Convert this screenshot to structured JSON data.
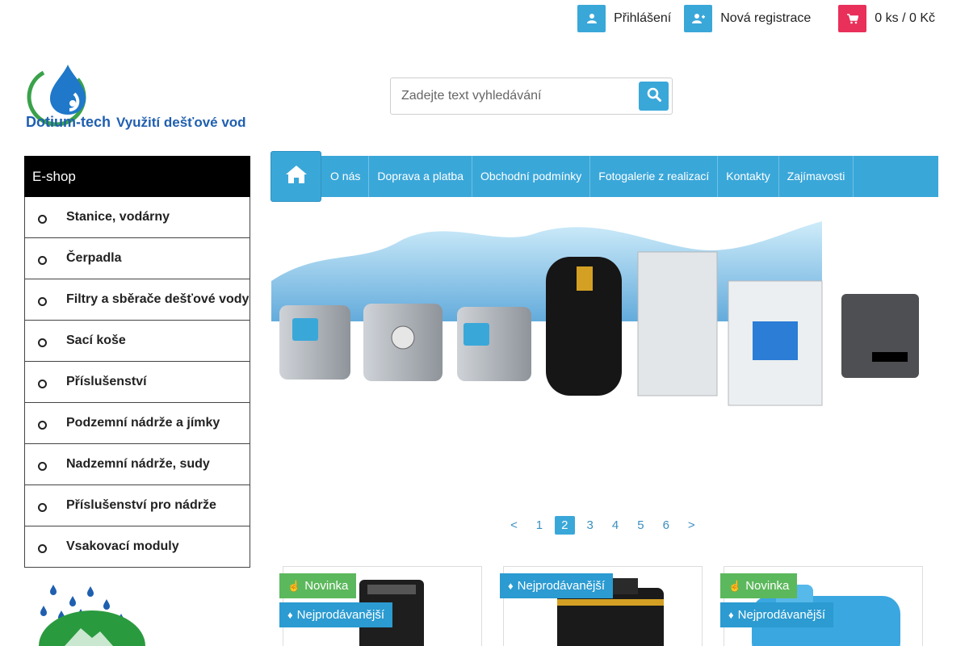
{
  "topbar": {
    "login_label": "Přihlášení",
    "register_label": "Nová registrace",
    "cart_label": "0 ks / 0 Kč"
  },
  "logo": {
    "name": "Dotium-tech",
    "tagline": "Využití dešťové vody"
  },
  "search": {
    "placeholder": "Zadejte text vyhledávání"
  },
  "sidebar": {
    "title": "E-shop",
    "items": [
      {
        "label": "Stanice, vodárny"
      },
      {
        "label": "Čerpadla"
      },
      {
        "label": "Filtry a sběrače dešťové vody"
      },
      {
        "label": "Sací koše"
      },
      {
        "label": "Příslušenství"
      },
      {
        "label": "Podzemní nádrže a jímky"
      },
      {
        "label": "Nadzemní nádrže, sudy"
      },
      {
        "label": "Příslušenství pro nádrže"
      },
      {
        "label": "Vsakovací moduly"
      }
    ]
  },
  "nav": {
    "links": [
      {
        "label": "O nás"
      },
      {
        "label": "Doprava a platba"
      },
      {
        "label": "Obchodní podmínky"
      },
      {
        "label": "Fotogalerie z realizací"
      },
      {
        "label": "Kontakty"
      },
      {
        "label": "Zajímavosti"
      }
    ]
  },
  "pager": {
    "prev": "<",
    "pages": [
      "1",
      "2",
      "3",
      "4",
      "5",
      "6"
    ],
    "active": "2",
    "next": ">"
  },
  "products": [
    {
      "badges": [
        {
          "type": "new",
          "label": "Novinka"
        },
        {
          "type": "best",
          "label": "Nejprodávanější"
        }
      ]
    },
    {
      "badges": [
        {
          "type": "best",
          "label": "Nejprodávanější"
        }
      ]
    },
    {
      "badges": [
        {
          "type": "new",
          "label": "Novinka"
        },
        {
          "type": "best",
          "label": "Nejprodávanější"
        }
      ]
    }
  ],
  "colors": {
    "accent": "#3aa7d9",
    "cart": "#e8305a",
    "badge_new": "#5cb85c",
    "badge_best": "#2b9bd1"
  }
}
